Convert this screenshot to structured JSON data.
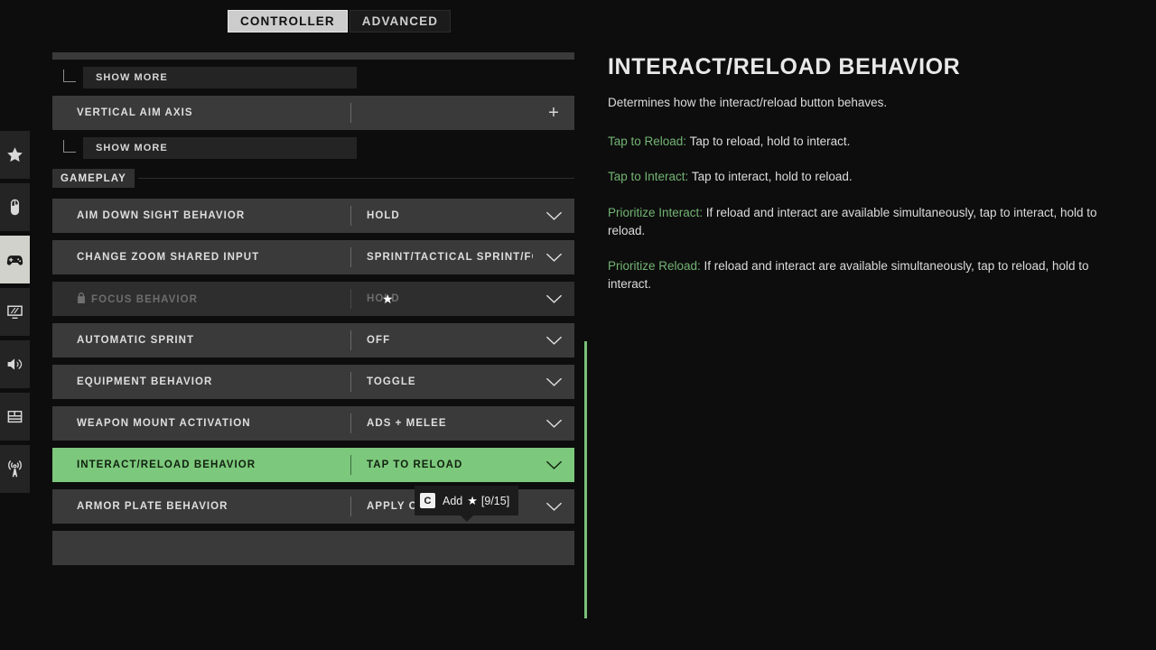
{
  "colors": {
    "highlight_green": "#7cc87c",
    "accent_green_text": "#73b473",
    "scrollbar_green": "#79c079",
    "row_background": "#3a3a3a",
    "panel_background": "#0d0d0d"
  },
  "sidebar": {
    "items": [
      {
        "name": "favorites",
        "icon": "star-icon",
        "active": false
      },
      {
        "name": "mouse-keyboard",
        "icon": "mouse-icon",
        "active": false
      },
      {
        "name": "controller",
        "icon": "gamepad-icon",
        "active": true
      },
      {
        "name": "graphics",
        "icon": "monitor-icon",
        "active": false
      },
      {
        "name": "audio",
        "icon": "speaker-icon",
        "active": false
      },
      {
        "name": "interface",
        "icon": "layout-icon",
        "active": false
      },
      {
        "name": "account-network",
        "icon": "broadcast-tower-icon",
        "active": false
      }
    ]
  },
  "tabs": [
    {
      "label": "CONTROLLER",
      "active": true
    },
    {
      "label": "ADVANCED",
      "active": false
    }
  ],
  "settings": {
    "partial_row_top": true,
    "rows": [
      {
        "type": "sub",
        "label": "SHOW MORE"
      },
      {
        "type": "setting",
        "label": "VERTICAL AIM AXIS",
        "value": "",
        "control": "plus-icon"
      },
      {
        "type": "sub",
        "label": "SHOW MORE"
      },
      {
        "type": "section",
        "label": "GAMEPLAY"
      },
      {
        "type": "setting",
        "label": "AIM DOWN SIGHT BEHAVIOR",
        "value": "HOLD",
        "control": "chevron-down-icon"
      },
      {
        "type": "setting",
        "label": "CHANGE ZOOM SHARED INPUT",
        "value": "SPRINT/TACTICAL SPRINT/FOCUS",
        "control": "chevron-down-icon"
      },
      {
        "type": "setting",
        "label": "FOCUS BEHAVIOR",
        "value": "HOLD",
        "control": "chevron-down-icon",
        "disabled": true,
        "locked": true,
        "starred": true
      },
      {
        "type": "setting",
        "label": "AUTOMATIC SPRINT",
        "value": "OFF",
        "control": "chevron-down-icon"
      },
      {
        "type": "setting",
        "label": "EQUIPMENT BEHAVIOR",
        "value": "TOGGLE",
        "control": "chevron-down-icon"
      },
      {
        "type": "setting",
        "label": "WEAPON MOUNT ACTIVATION",
        "value": "ADS + MELEE",
        "control": "chevron-down-icon"
      },
      {
        "type": "setting",
        "label": "INTERACT/RELOAD BEHAVIOR",
        "value": "TAP TO RELOAD",
        "control": "chevron-down-icon",
        "selected": true
      },
      {
        "type": "setting",
        "label": "ARMOR PLATE BEHAVIOR",
        "value": "APPLY ONE",
        "control": "chevron-down-icon"
      }
    ]
  },
  "tooltip": {
    "key": "C",
    "action": "Add",
    "star_icon": "star-icon",
    "count": "[9/15]"
  },
  "detail": {
    "title": "INTERACT/RELOAD BEHAVIOR",
    "description": "Determines how the interact/reload button behaves.",
    "options": [
      {
        "name": "Tap to Reload:",
        "text": " Tap to reload, hold to interact."
      },
      {
        "name": "Tap to Interact:",
        "text": " Tap to interact, hold to reload."
      },
      {
        "name": "Prioritize Interact:",
        "text": " If reload and interact are available simultaneously, tap to interact, hold to reload."
      },
      {
        "name": "Prioritize Reload:",
        "text": " If reload and interact are available simultaneously, tap to reload, hold to interact."
      }
    ]
  }
}
